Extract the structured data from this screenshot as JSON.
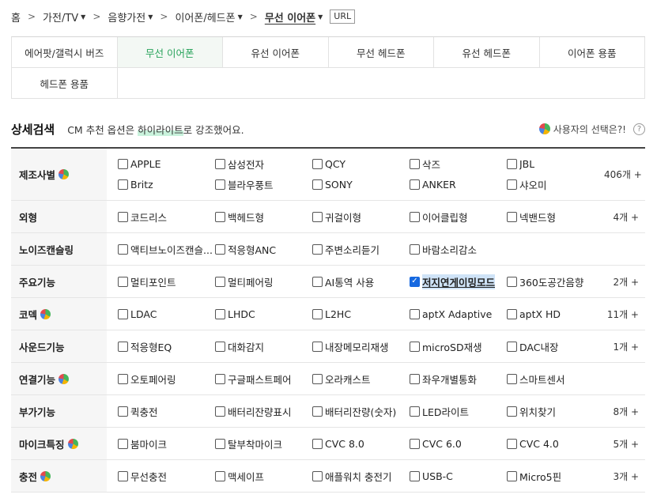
{
  "breadcrumb": {
    "home": "홈",
    "items": [
      {
        "label": "가전/TV"
      },
      {
        "label": "음향가전"
      },
      {
        "label": "이어폰/헤드폰"
      }
    ],
    "current": "무선 이어폰",
    "url_label": "URL"
  },
  "category_tabs": {
    "row1": [
      "에어팟/갤럭시 버즈",
      "무선 이어폰",
      "유선 이어폰",
      "무선 헤드폰",
      "유선 헤드폰",
      "이어폰 용품"
    ],
    "row2": [
      "헤드폰 용품"
    ],
    "active": "무선 이어폰"
  },
  "search_header": {
    "title": "상세검색",
    "note_prefix": "CM 추천 옵션은 ",
    "note_highlight": "하이라이트",
    "note_suffix": "로 강조했어요.",
    "user_choice": "사용자의 선택은?!",
    "help": "?"
  },
  "filters": [
    {
      "label": "제조사별",
      "pie": true,
      "options": [
        "APPLE",
        "삼성전자",
        "QCY",
        "삭즈",
        "JBL",
        "Britz",
        "블라우풍트",
        "SONY",
        "ANKER",
        "샤오미"
      ],
      "more": "406개 +"
    },
    {
      "label": "외형",
      "pie": false,
      "options": [
        "코드리스",
        "백헤드형",
        "귀걸이형",
        "이어클립형",
        "넥밴드형"
      ],
      "more": "4개 +"
    },
    {
      "label": "노이즈캔슬링",
      "pie": false,
      "options": [
        "액티브노이즈캔슬...",
        "적응형ANC",
        "주변소리듣기",
        "바람소리감소"
      ],
      "more": ""
    },
    {
      "label": "주요기능",
      "pie": false,
      "options": [
        "멀티포인트",
        "멀티페어링",
        "AI통역 사용",
        "저지연게이밍모드",
        "360도공간음향"
      ],
      "more": "2개 +"
    },
    {
      "label": "코덱",
      "pie": true,
      "options": [
        "LDAC",
        "LHDC",
        "L2HC",
        "aptX Adaptive",
        "aptX HD"
      ],
      "more": "11개 +"
    },
    {
      "label": "사운드기능",
      "pie": false,
      "options": [
        "적응형EQ",
        "대화감지",
        "내장메모리재생",
        "microSD재생",
        "DAC내장"
      ],
      "more": "1개 +"
    },
    {
      "label": "연결기능",
      "pie": true,
      "options": [
        "오토페어링",
        "구글패스트페어",
        "오라캐스트",
        "좌우개별통화",
        "스마트센서"
      ],
      "more": ""
    },
    {
      "label": "부가기능",
      "pie": false,
      "options": [
        "퀵충전",
        "배터리잔량표시",
        "배터리잔량(숫자)",
        "LED라이트",
        "위치찾기"
      ],
      "more": "8개 +"
    },
    {
      "label": "마이크특징",
      "pie": true,
      "options": [
        "붐마이크",
        "탈부착마이크",
        "CVC 8.0",
        "CVC 6.0",
        "CVC 4.0"
      ],
      "more": "5개 +"
    },
    {
      "label": "충전",
      "pie": true,
      "options": [
        "무선충전",
        "맥세이프",
        "애플워치 충전기",
        "USB-C",
        "Micro5핀"
      ],
      "more": "3개 +"
    }
  ],
  "checked_option": "저지연게이밍모드"
}
